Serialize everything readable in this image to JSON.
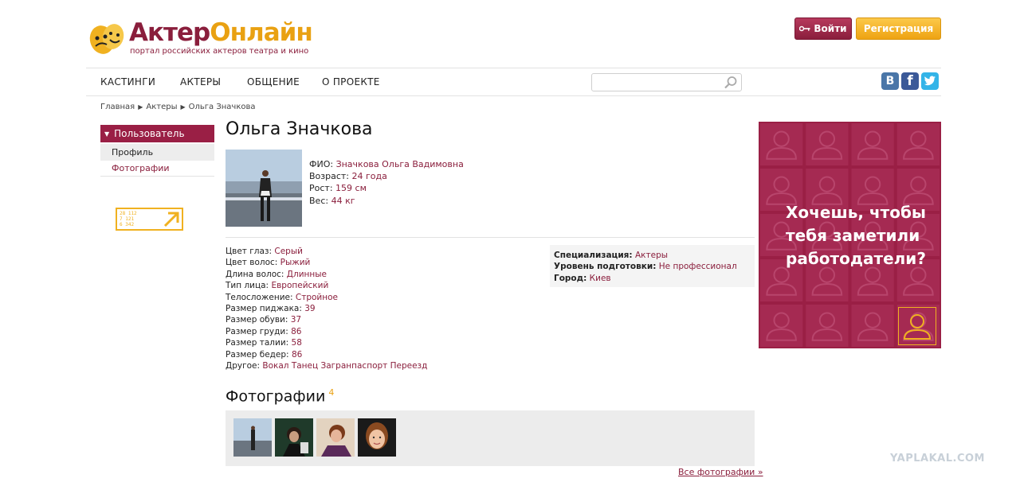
{
  "header": {
    "logo_part1": "Актер",
    "logo_part2": "Онлайн",
    "tagline": "портал российских актеров театра и кино",
    "login_label": "Войти",
    "register_label": "Регистрация"
  },
  "nav": {
    "items": [
      "КАСТИНГИ",
      "АКТЕРЫ",
      "ОБЩЕНИЕ",
      "О ПРОЕКТЕ"
    ],
    "search_placeholder": ""
  },
  "social": {
    "vk": "B",
    "fb": "f"
  },
  "breadcrumb": [
    "Главная",
    "Актеры",
    "Ольга Значкова"
  ],
  "sidebar": {
    "header": "Пользователь",
    "items": [
      "Профиль",
      "Фотографии"
    ],
    "counter_lines": [
      "28 112",
      "7 121",
      "6 342"
    ]
  },
  "profile": {
    "name": "Ольга Значкова",
    "basic": [
      {
        "key": "ФИО:",
        "value": "Значкова Ольга Вадимовна"
      },
      {
        "key": "Возраст:",
        "value": "24 года"
      },
      {
        "key": "Рост:",
        "value": "159 см"
      },
      {
        "key": "Вес:",
        "value": "44 кг"
      }
    ],
    "details": [
      {
        "key": "Цвет глаз:",
        "value": "Серый"
      },
      {
        "key": "Цвет волос:",
        "value": "Рыжий"
      },
      {
        "key": "Длина волос:",
        "value": "Длинные"
      },
      {
        "key": "Тип лица:",
        "value": "Европейский"
      },
      {
        "key": "Телосложение:",
        "value": "Стройное"
      },
      {
        "key": "Размер пиджака:",
        "value": "39"
      },
      {
        "key": "Размер обуви:",
        "value": "37"
      },
      {
        "key": "Размер груди:",
        "value": "86"
      },
      {
        "key": "Размер талии:",
        "value": "58"
      },
      {
        "key": "Размер бедер:",
        "value": "86"
      },
      {
        "key": "Другое:",
        "value": "Вокал Танец Загранпаспорт Переезд"
      }
    ],
    "spec": [
      {
        "key": "Специализация:",
        "value": "Актеры"
      },
      {
        "key": "Уровень подготовки:",
        "value": "Не профессионал"
      },
      {
        "key": "Город:",
        "value": "Киев"
      }
    ]
  },
  "photos": {
    "title": "Фотографии",
    "count": "4",
    "all_link": "Все фотографии »"
  },
  "banner": {
    "lines": [
      "Хочешь, чтобы",
      "тебя заметили",
      "работодатели?"
    ]
  },
  "watermark": "YAPLAKAL.COM",
  "colors": {
    "brand": "#8a1e3c",
    "accent": "#e9a112",
    "banner": "#9a1f45"
  }
}
